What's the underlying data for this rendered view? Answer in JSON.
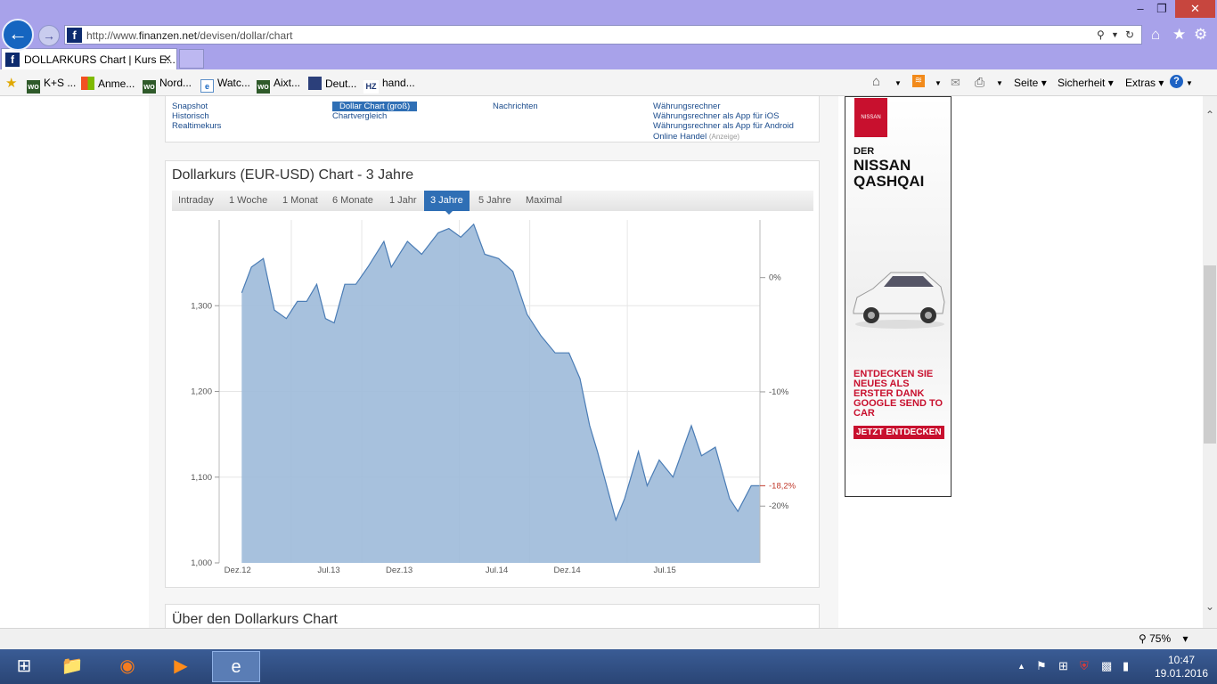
{
  "browser": {
    "url_prefix": "http://www.",
    "url_domain": "finanzen.net",
    "url_path": "/devisen/dollar/chart",
    "tab_title": "DOLLARKURS Chart | Kurs E...",
    "favorites": [
      "K+S ...",
      "Anme...",
      "Nord...",
      "Watc...",
      "Aixt...",
      "Deut...",
      "hand..."
    ],
    "commands": [
      "Seite",
      "Sicherheit",
      "Extras"
    ],
    "zoom": "75%"
  },
  "links": {
    "col1": [
      "Snapshot",
      "Historisch",
      "Realtimekurs"
    ],
    "col2": [
      "Dollar Chart (groß)",
      "Chartvergleich"
    ],
    "col3": [
      "Nachrichten"
    ],
    "col4": [
      "Währungsrechner",
      "Währungsrechner als App für iOS",
      "Währungsrechner als App für Android",
      "Online Handel"
    ],
    "anzeige": "(Anzeige)"
  },
  "chart_title": "Dollarkurs (EUR-USD) Chart - 3 Jahre",
  "ranges": [
    "Intraday",
    "1 Woche",
    "1 Monat",
    "6 Monate",
    "1 Jahr",
    "3 Jahre",
    "5 Jahre",
    "Maximal"
  ],
  "active_range": "3 Jahre",
  "about_title": "Über den Dollarkurs Chart",
  "ad": {
    "brand": "NISSAN",
    "der": "DER",
    "model_line1": "NISSAN",
    "model_line2": "QASHQAI",
    "text": "ENTDECKEN SIE NEUES ALS ERSTER DANK GOOGLE SEND TO CAR",
    "button": "JETZT ENTDECKEN"
  },
  "chart_data": {
    "type": "area",
    "x": [
      "2012-12-20",
      "2013-01-10",
      "2013-02-05",
      "2013-03-01",
      "2013-03-27",
      "2013-04-20",
      "2013-05-10",
      "2013-06-01",
      "2013-06-20",
      "2013-07-09",
      "2013-08-01",
      "2013-08-25",
      "2013-09-20",
      "2013-10-25",
      "2013-11-10",
      "2013-12-15",
      "2014-01-15",
      "2014-02-20",
      "2014-03-15",
      "2014-04-10",
      "2014-05-08",
      "2014-06-01",
      "2014-07-01",
      "2014-08-01",
      "2014-09-01",
      "2014-10-01",
      "2014-11-01",
      "2014-12-01",
      "2014-12-25",
      "2015-01-15",
      "2015-02-01",
      "2015-03-13",
      "2015-04-01",
      "2015-05-01",
      "2015-05-20",
      "2015-06-15",
      "2015-07-15",
      "2015-08-24",
      "2015-09-15",
      "2015-10-15",
      "2015-11-15",
      "2015-12-03",
      "2016-01-01",
      "2016-01-19"
    ],
    "y": [
      1.315,
      1.345,
      1.355,
      1.295,
      1.285,
      1.305,
      1.305,
      1.325,
      1.285,
      1.28,
      1.325,
      1.325,
      1.345,
      1.375,
      1.345,
      1.375,
      1.36,
      1.385,
      1.39,
      1.38,
      1.395,
      1.36,
      1.355,
      1.34,
      1.29,
      1.265,
      1.245,
      1.245,
      1.215,
      1.16,
      1.13,
      1.05,
      1.075,
      1.13,
      1.09,
      1.12,
      1.1,
      1.16,
      1.125,
      1.135,
      1.075,
      1.06,
      1.09,
      1.09
    ],
    "x_ticks": [
      "Dez.12",
      "Jul.13",
      "Dez.13",
      "Jul.14",
      "Dez.14",
      "Jul.15"
    ],
    "y_ticks": [
      "1,300",
      "1,200",
      "1,100",
      "1,000"
    ],
    "ylim": [
      1.0,
      1.4
    ],
    "right_ticks": [
      "0%",
      "-10%",
      "-20%"
    ],
    "current_change": "-18,2%",
    "color": "#9dbad9"
  },
  "taskbar": {
    "time": "10:47",
    "date": "19.01.2016"
  }
}
